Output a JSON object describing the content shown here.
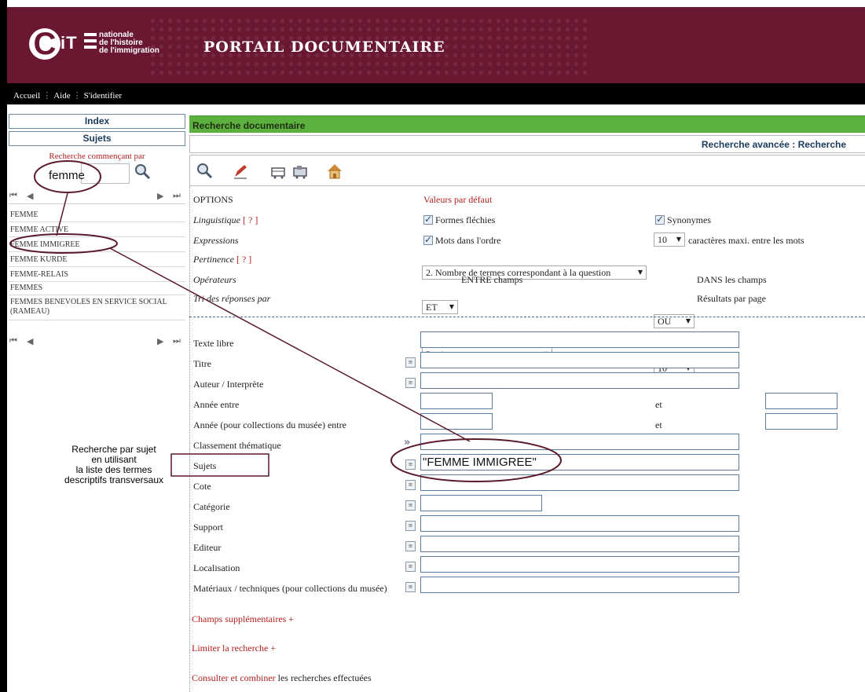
{
  "header": {
    "logo_mark": "CiT",
    "logo_lines": [
      "nationale",
      "de l'histoire",
      "de l'immigration"
    ],
    "portal_title": "PORTAIL DOCUMENTAIRE"
  },
  "nav": {
    "items": [
      "Accueil",
      "Aide",
      "S'identifier"
    ]
  },
  "sidebar": {
    "index_label": "Index",
    "sujets_label": "Sujets",
    "search_prompt": "Recherche commençant par",
    "search_value": "femme",
    "terms": [
      "FEMME",
      "FEMME ACTIVE",
      "FEMME IMMIGREE",
      "FEMME KURDE",
      "FEMME-RELAIS",
      "FEMMES",
      "FEMMES BENEVOLES EN SERVICE SOCIAL (RAMEAU)"
    ],
    "caption": [
      "Recherche  par sujet",
      "en utilisant",
      "la liste des termes",
      "descriptifs transversaux"
    ]
  },
  "main": {
    "section_title": "Recherche documentaire",
    "breadcrumb": "Recherche avancée : Recherche",
    "options": {
      "heading": "OPTIONS",
      "defaults": "Valeurs par défaut",
      "linguistique": "Linguistique",
      "help": "[ ? ]",
      "formes": "Formes fléchies",
      "synonymes": "Synonymes",
      "expressions": "Expressions",
      "mots_ordre": "Mots dans l'ordre",
      "max_chars_value": "10",
      "max_chars_label": "caractères maxi. entre les mots",
      "pertinence": "Pertinence",
      "pertinence_value": "2. Nombre de termes correspondant à la question",
      "operateurs": "Opérateurs",
      "op_between_value": "ET",
      "op_between_label": "ENTRE champs",
      "op_within_value": "OU",
      "op_within_label": "DANS les champs",
      "tri": "Tri des réponses par",
      "tri_value": "Pertinence",
      "per_page_value": "10",
      "per_page_label": "Résultats par page"
    },
    "fields": {
      "texte_libre": "Texte libre",
      "titre": "Titre",
      "auteur": "Auteur / Interprète",
      "annee": "Année entre",
      "annee_musee": "Année (pour collections du musée) entre",
      "et": "et",
      "classement": "Classement thématique",
      "sujets": "Sujets",
      "sujets_value": "\"FEMME IMMIGREE\"",
      "cote": "Cote",
      "categorie": "Catégorie",
      "support": "Support",
      "editeur": "Editeur",
      "localisation": "Localisation",
      "materiaux": "Matériaux / techniques (pour collections du musée)"
    },
    "links": {
      "champs_supp": "Champs supplémentaires +",
      "limiter": "Limiter la recherche +",
      "consulter_red": "Consulter et combiner",
      "consulter_rest": " les recherches effectuées"
    }
  },
  "colors": {
    "header": "#6a1832",
    "green_bar": "#5cb13e",
    "annotation": "#5a1a2a"
  }
}
